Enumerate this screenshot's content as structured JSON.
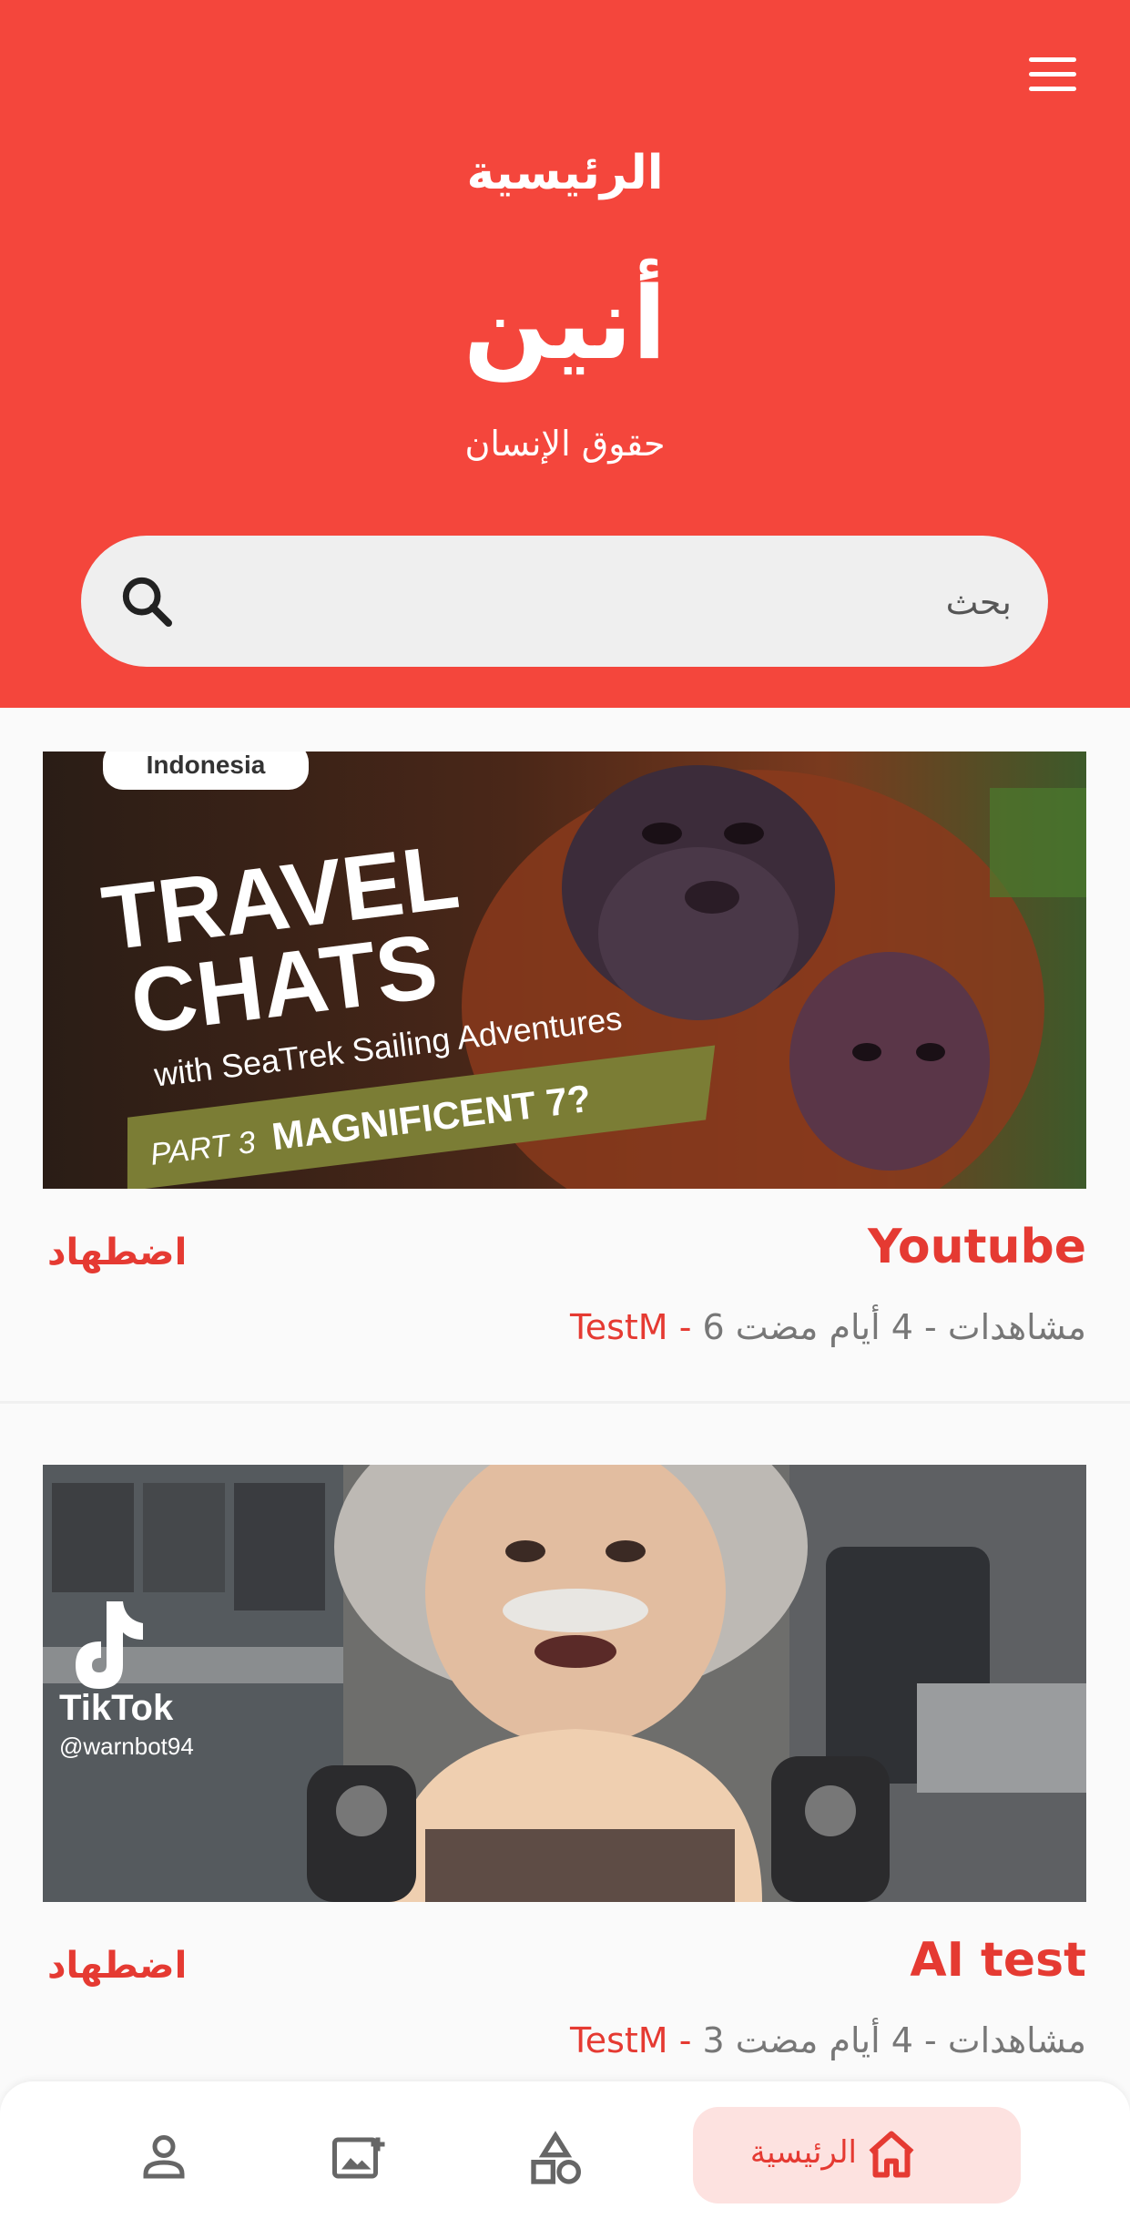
{
  "header": {
    "page_title": "الرئيسية",
    "brand_name": "أنين",
    "brand_tagline": "حقوق الإنسان",
    "search_placeholder": "بحث"
  },
  "icons": {
    "menu": "menu-icon",
    "search": "search-icon",
    "profile": "person-icon",
    "gallery": "image-icon",
    "categories": "shapes-icon",
    "home": "home-icon"
  },
  "colors": {
    "primary": "#f4463c",
    "accent_text": "#e53a32",
    "nav_active_bg": "#fde2e0"
  },
  "videos": [
    {
      "title": "Youtube",
      "channel": "TestM",
      "stats": "6 مشاهدات - 4 أيام مضت",
      "category": "اضطهاد",
      "thumbnail": {
        "badge": "Indonesia",
        "line1": "TRAVEL",
        "line2": "CHATS",
        "line3": "with SeaTrek Sailing Adventures",
        "part": "PART 3",
        "headline": "MAGNIFICENT 7?"
      }
    },
    {
      "title": "AI test",
      "channel": "TestM",
      "stats": "3 مشاهدات - 4 أيام مضت",
      "category": "اضطهاد",
      "thumbnail": {
        "watermark": "TikTok",
        "handle": "@warnbot94"
      }
    }
  ],
  "bottom_nav": {
    "home_label": "الرئيسية"
  }
}
